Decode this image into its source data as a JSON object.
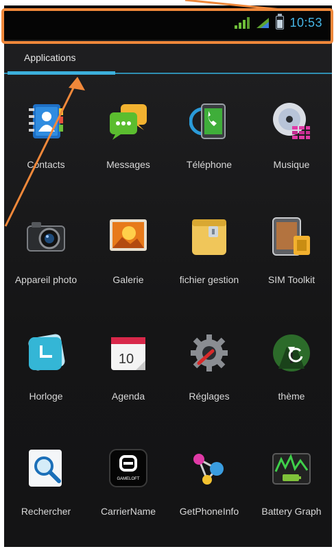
{
  "status_bar": {
    "time": "10:53",
    "icons": [
      "signal-icon",
      "wifi-icon",
      "battery-icon"
    ]
  },
  "tabs": {
    "active": "Applications"
  },
  "apps": [
    {
      "label": "Contacts",
      "icon": "contacts-icon"
    },
    {
      "label": "Messages",
      "icon": "messages-icon"
    },
    {
      "label": "Téléphone",
      "icon": "phone-icon"
    },
    {
      "label": "Musique",
      "icon": "music-icon"
    },
    {
      "label": "Appareil photo",
      "icon": "camera-icon"
    },
    {
      "label": "Galerie",
      "icon": "gallery-icon"
    },
    {
      "label": "fichier gestion",
      "icon": "file-manager-icon"
    },
    {
      "label": "SIM Toolkit",
      "icon": "sim-toolkit-icon"
    },
    {
      "label": "Horloge",
      "icon": "clock-icon"
    },
    {
      "label": "Agenda",
      "icon": "calendar-icon"
    },
    {
      "label": "Réglages",
      "icon": "settings-icon"
    },
    {
      "label": "thème",
      "icon": "theme-icon"
    },
    {
      "label": "Rechercher",
      "icon": "search-icon"
    },
    {
      "label": "CarrierName",
      "icon": "carriername-icon"
    },
    {
      "label": "GetPhoneInfo",
      "icon": "phone-info-icon"
    },
    {
      "label": "Battery Graph",
      "icon": "battery-graph-icon"
    }
  ],
  "calendar_day": "10",
  "carrier_logo_text": "GAMELOFT",
  "colors": {
    "accent": "#3cb0dc",
    "annotation": "#f0883a",
    "clock": "#46b7e8"
  }
}
